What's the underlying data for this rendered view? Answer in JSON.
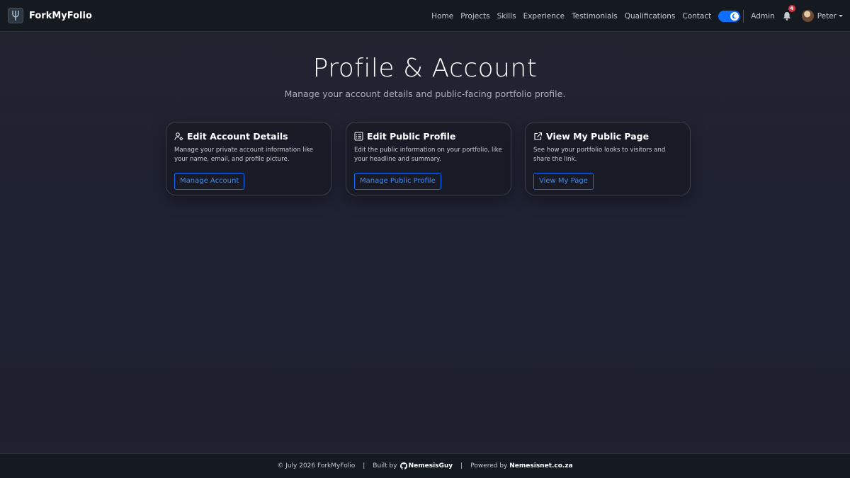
{
  "brand": {
    "name": "ForkMyFolio",
    "logo_icon": "fork-logo-icon"
  },
  "nav": {
    "links": [
      "Home",
      "Projects",
      "Skills",
      "Experience",
      "Testimonials",
      "Qualifications",
      "Contact"
    ],
    "admin": "Admin",
    "notifications_count": "4",
    "user_name": "Peter"
  },
  "header": {
    "title": "Profile & Account",
    "subtitle": "Manage your account details and public-facing portfolio profile."
  },
  "cards": [
    {
      "icon": "person-gear-icon",
      "title": "Edit Account Details",
      "text": "Manage your private account information like your name, email, and profile picture.",
      "button": "Manage Account"
    },
    {
      "icon": "document-list-icon",
      "title": "Edit Public Profile",
      "text": "Edit the public information on your portfolio, like your headline and summary.",
      "button": "Manage Public Profile"
    },
    {
      "icon": "external-link-icon",
      "title": "View My Public Page",
      "text": "See how your portfolio looks to visitors and share the link.",
      "button": "View My Page"
    }
  ],
  "footer": {
    "copyright": "© July 2026 ForkMyFolio",
    "built_by_prefix": "Built by",
    "built_by_name": "NemesisGuy",
    "powered_by_prefix": "Powered by",
    "powered_by_name": "Nemesisnet.co.za"
  },
  "colors": {
    "accent": "#0d6efd",
    "badge": "#dc3545",
    "navbar_bg": "#141a1f"
  }
}
